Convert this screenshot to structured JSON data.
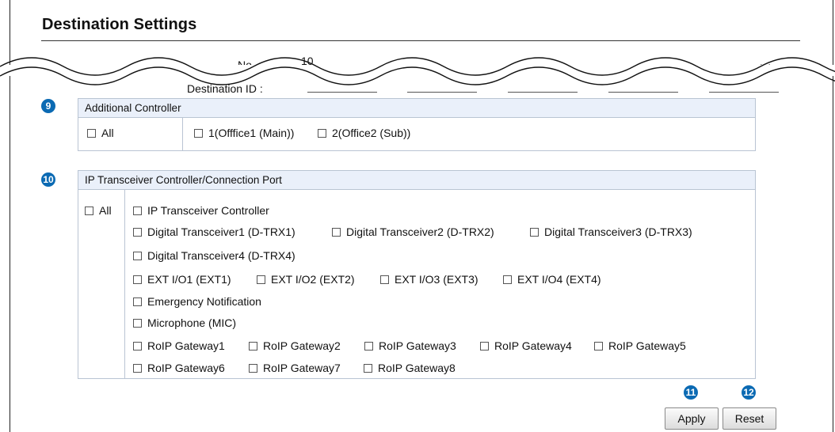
{
  "page": {
    "title": "Destination Settings"
  },
  "fields": {
    "no_label": "No. :",
    "no_value": "10",
    "destination_id_label": "Destination ID :"
  },
  "callouts": {
    "additional_controller": "9",
    "ip_transceiver": "10",
    "apply": "11",
    "reset": "12"
  },
  "additional_controller": {
    "header": "Additional Controller",
    "all_label": "All",
    "options": [
      "1(Offfice1 (Main))",
      "2(Office2 (Sub))"
    ]
  },
  "ip_transceiver": {
    "header": "IP Transceiver Controller/Connection Port",
    "all_label": "All",
    "rows": [
      [
        "IP Transceiver Controller"
      ],
      [
        "Digital Transceiver1 (D-TRX1)",
        "Digital Transceiver2 (D-TRX2)",
        "Digital Transceiver3 (D-TRX3)"
      ],
      [
        "Digital Transceiver4 (D-TRX4)"
      ],
      [
        "EXT I/O1 (EXT1)",
        "EXT I/O2 (EXT2)",
        "EXT I/O3 (EXT3)",
        "EXT I/O4 (EXT4)"
      ],
      [
        "Emergency Notification"
      ],
      [
        "Microphone (MIC)"
      ],
      [
        "RoIP Gateway1",
        "RoIP Gateway2",
        "RoIP Gateway3",
        "RoIP Gateway4",
        "RoIP Gateway5"
      ],
      [
        "RoIP Gateway6",
        "RoIP Gateway7",
        "RoIP Gateway8"
      ]
    ]
  },
  "buttons": {
    "apply": "Apply",
    "reset": "Reset"
  },
  "icons": {
    "dropdown": "chevron-down-icon",
    "checkbox": "checkbox-icon"
  },
  "colors": {
    "callout": "#0b6ab3",
    "panel_header": "#eaf0fa",
    "panel_border": "#b9c4d3"
  }
}
